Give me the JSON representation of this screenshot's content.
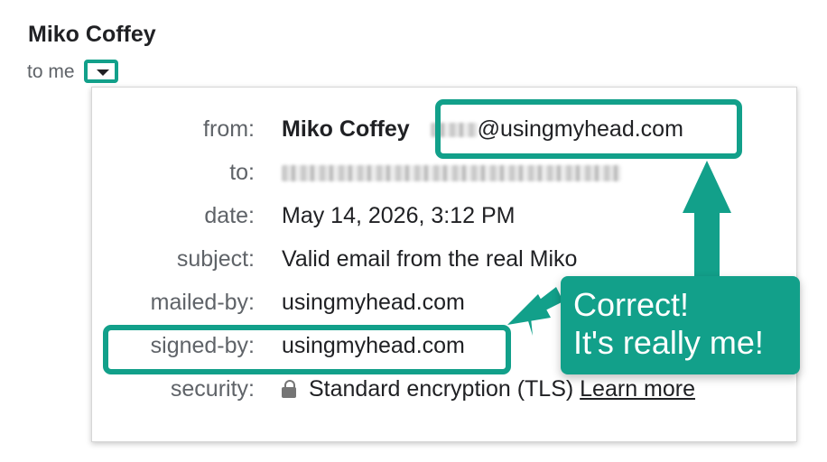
{
  "header": {
    "sender_name": "Miko Coffey",
    "recipient_summary": "to me"
  },
  "details": {
    "from": {
      "label": "from:",
      "name": "Miko Coffey",
      "email_domain": "@usingmyhead.com"
    },
    "to": {
      "label": "to:"
    },
    "date": {
      "label": "date:",
      "value": "May 14, 2026, 3:12 PM"
    },
    "subject": {
      "label": "subject:",
      "value": "Valid email from the real Miko"
    },
    "mailed_by": {
      "label": "mailed-by:",
      "value": "usingmyhead.com"
    },
    "signed_by": {
      "label": "signed-by:",
      "value": "usingmyhead.com"
    },
    "security": {
      "label": "security:",
      "value": "Standard encryption (TLS)",
      "link": "Learn more",
      "icon": "lock-icon"
    }
  },
  "annotation": {
    "line1": "Correct!",
    "line2": "It's really me!",
    "color": "#12a08a"
  }
}
